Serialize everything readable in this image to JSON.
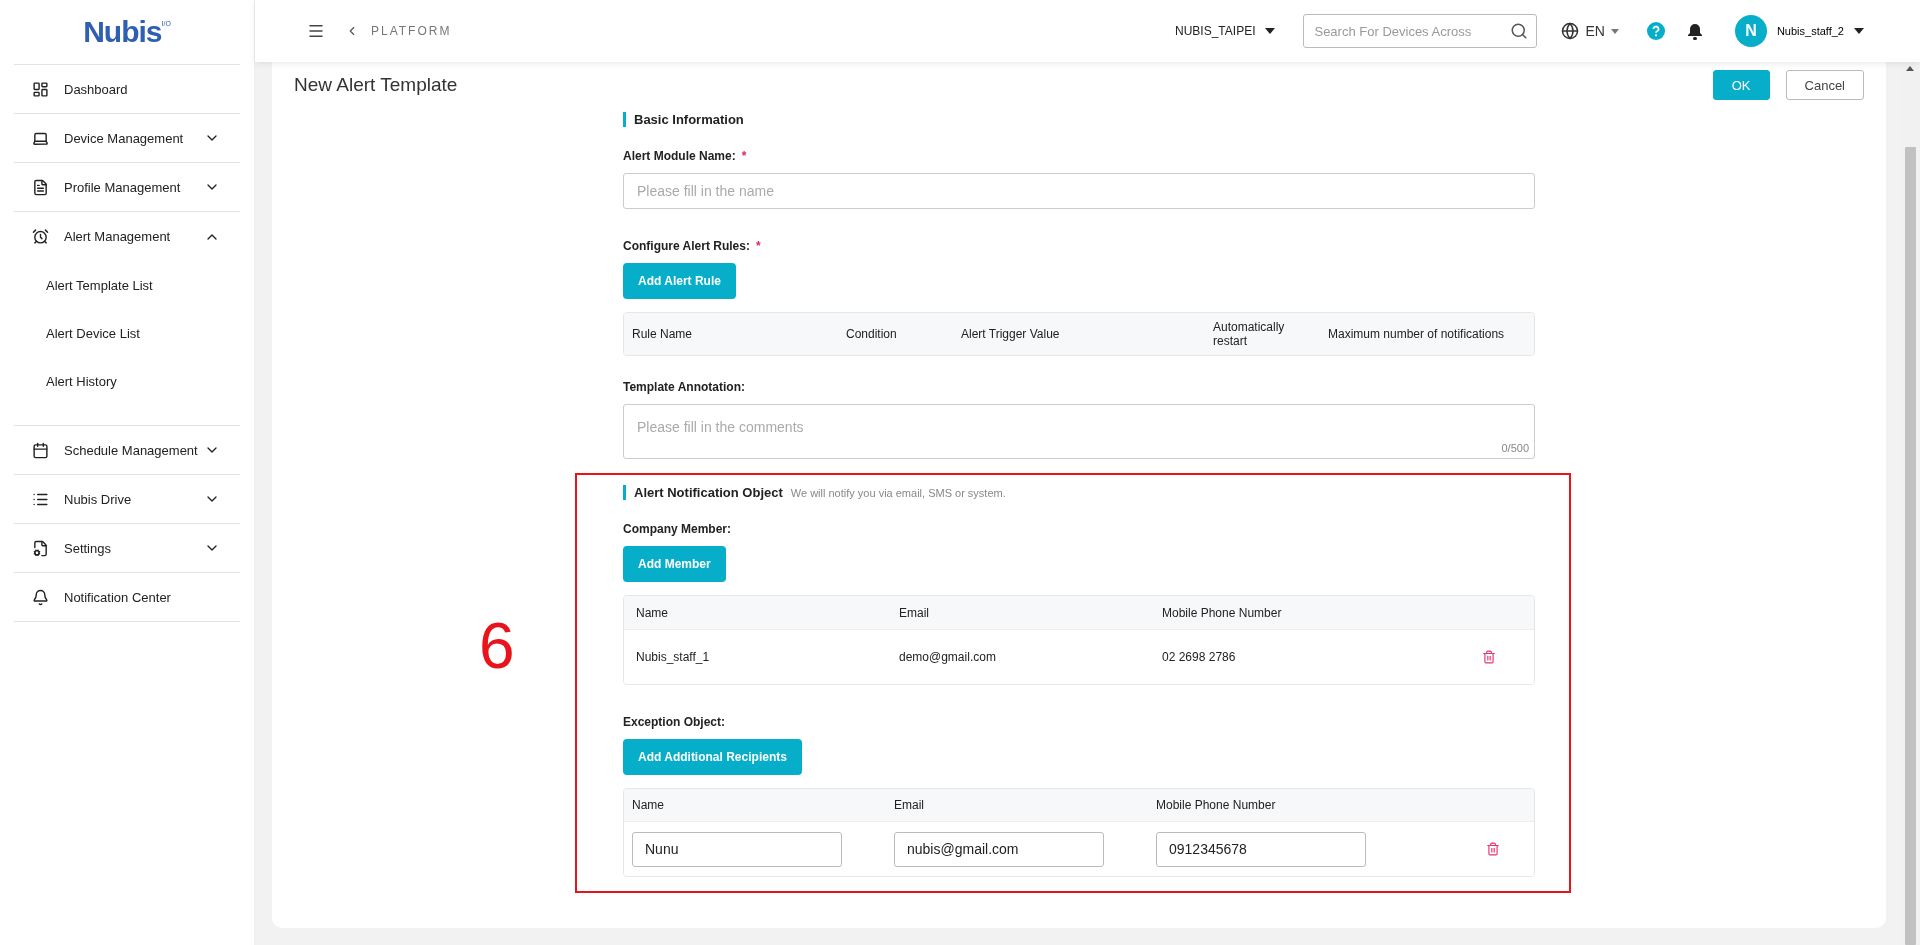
{
  "logo": {
    "text": "Nubis",
    "superscript": "I/O"
  },
  "sidebar": {
    "items": [
      {
        "label": "Dashboard",
        "kind": "link"
      },
      {
        "label": "Device Management",
        "kind": "group",
        "expanded": false
      },
      {
        "label": "Profile Management",
        "kind": "group",
        "expanded": false
      },
      {
        "label": "Alert Management",
        "kind": "group",
        "expanded": true,
        "children": [
          {
            "label": "Alert Template List"
          },
          {
            "label": "Alert Device List"
          },
          {
            "label": "Alert History"
          }
        ]
      },
      {
        "label": "Schedule Management",
        "kind": "group",
        "expanded": false
      },
      {
        "label": "Nubis Drive",
        "kind": "group",
        "expanded": false
      },
      {
        "label": "Settings",
        "kind": "group",
        "expanded": false
      },
      {
        "label": "Notification Center",
        "kind": "link"
      }
    ]
  },
  "header": {
    "breadcrumb": "PLATFORM",
    "site": "NUBIS_TAIPEI",
    "search": {
      "placeholder": "Search For Devices Across"
    },
    "language": "EN",
    "user": {
      "initial": "N",
      "name": "Nubis_staff_2"
    }
  },
  "page": {
    "title": "New Alert Template",
    "actions": [
      {
        "label": "OK",
        "kind": "primary"
      },
      {
        "label": "Cancel",
        "kind": "secondary"
      }
    ]
  },
  "basic_information": {
    "title": "Basic Information",
    "module_name": {
      "label": "Alert Module Name:",
      "required_mark": "*",
      "placeholder": "Please fill in the name"
    },
    "alert_rules": {
      "label": "Configure Alert Rules:",
      "required_mark": "*",
      "button": "Add Alert Rule",
      "columns": [
        "Rule Name",
        "Condition",
        "Alert Trigger Value",
        "Automatically restart",
        "Maximum number of notifications"
      ]
    },
    "annotation": {
      "label": "Template Annotation:",
      "placeholder": "Please fill in the comments",
      "counter": "0/500"
    }
  },
  "alert_notification_object": {
    "title": "Alert Notification Object",
    "hint": "We will notify you via email, SMS or system.",
    "company_member": {
      "label": "Company Member:",
      "button": "Add Member",
      "columns": [
        "Name",
        "Email",
        "Mobile Phone Number"
      ],
      "rows": [
        {
          "name": "Nubis_staff_1",
          "email": "demo@gmail.com",
          "phone": "02 2698 2786"
        }
      ]
    },
    "exception_object": {
      "label": "Exception Object:",
      "button": "Add Additional Recipients",
      "columns": [
        "Name",
        "Email",
        "Mobile Phone Number"
      ],
      "rows": [
        {
          "name": "Nunu",
          "email": "nubis@gmail.com",
          "phone": "0912345678"
        }
      ]
    }
  },
  "annotation_mark": {
    "label": "6"
  }
}
